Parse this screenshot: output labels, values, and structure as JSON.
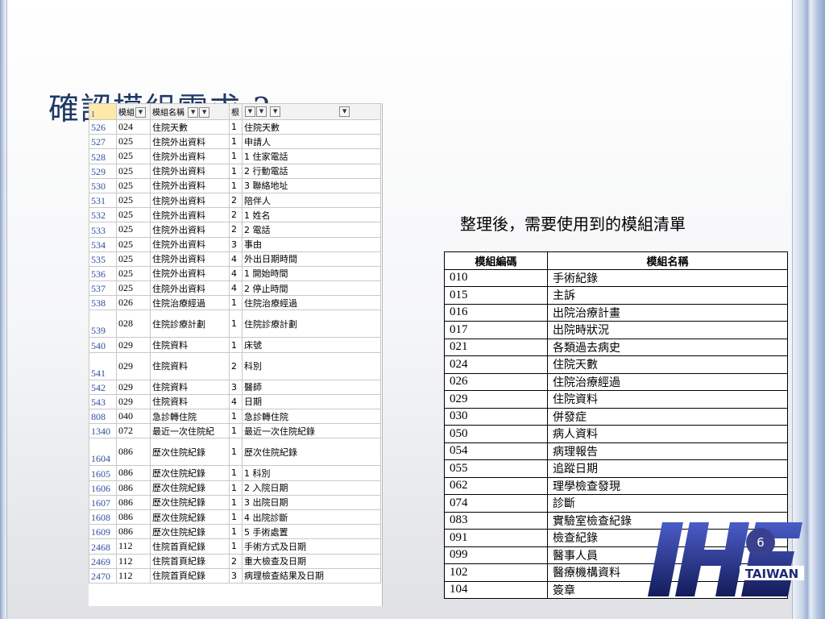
{
  "slide": {
    "title": "確認模組需求 ?",
    "caption": "整理後，需要使用到的模組清單",
    "page_number": "6"
  },
  "sheet": {
    "header": {
      "row": "1",
      "col_a": "模組",
      "col_b": "模組名稱",
      "col_c": "根",
      "col_d": ""
    },
    "rows": [
      {
        "rn": "526",
        "code": "024",
        "name": "住院天數",
        "n": "1",
        "item": "住院天數",
        "tall": false
      },
      {
        "rn": "527",
        "code": "025",
        "name": "住院外出資料",
        "n": "1",
        "item": "申請人",
        "tall": false
      },
      {
        "rn": "528",
        "code": "025",
        "name": "住院外出資料",
        "n": "1",
        "item": "1  住家電話",
        "tall": false
      },
      {
        "rn": "529",
        "code": "025",
        "name": "住院外出資料",
        "n": "1",
        "item": "2  行動電話",
        "tall": false
      },
      {
        "rn": "530",
        "code": "025",
        "name": "住院外出資料",
        "n": "1",
        "item": "3  聯絡地址",
        "tall": false
      },
      {
        "rn": "531",
        "code": "025",
        "name": "住院外出資料",
        "n": "2",
        "item": "陪伴人",
        "tall": false
      },
      {
        "rn": "532",
        "code": "025",
        "name": "住院外出資料",
        "n": "2",
        "item": "1  姓名",
        "tall": false
      },
      {
        "rn": "533",
        "code": "025",
        "name": "住院外出資料",
        "n": "2",
        "item": "2  電話",
        "tall": false
      },
      {
        "rn": "534",
        "code": "025",
        "name": "住院外出資料",
        "n": "3",
        "item": "事由",
        "tall": false
      },
      {
        "rn": "535",
        "code": "025",
        "name": "住院外出資料",
        "n": "4",
        "item": "外出日期時間",
        "tall": false
      },
      {
        "rn": "536",
        "code": "025",
        "name": "住院外出資料",
        "n": "4",
        "item": "1  開始時間",
        "tall": false
      },
      {
        "rn": "537",
        "code": "025",
        "name": "住院外出資料",
        "n": "4",
        "item": "2  停止時間",
        "tall": false
      },
      {
        "rn": "538",
        "code": "026",
        "name": "住院治療經過",
        "n": "1",
        "item": "住院治療經過",
        "tall": false
      },
      {
        "rn": "539",
        "code": "028",
        "name": "住院診療計劃",
        "n": "1",
        "item": "住院診療計劃",
        "tall": true
      },
      {
        "rn": "540",
        "code": "029",
        "name": "住院資料",
        "n": "1",
        "item": "床號",
        "tall": false
      },
      {
        "rn": "541",
        "code": "029",
        "name": "住院資料",
        "n": "2",
        "item": "科別",
        "tall": true
      },
      {
        "rn": "542",
        "code": "029",
        "name": "住院資料",
        "n": "3",
        "item": "醫師",
        "tall": false
      },
      {
        "rn": "543",
        "code": "029",
        "name": "住院資料",
        "n": "4",
        "item": "日期",
        "tall": false
      },
      {
        "rn": "808",
        "code": "040",
        "name": "急診轉住院",
        "n": "1",
        "item": "急診轉住院",
        "tall": false
      },
      {
        "rn": "1340",
        "code": "072",
        "name": "最近一次住院紀",
        "n": "1",
        "item": "最近一次住院紀錄",
        "tall": false
      },
      {
        "rn": "1604",
        "code": "086",
        "name": "歷次住院紀錄",
        "n": "1",
        "item": "歷次住院紀錄",
        "tall": true
      },
      {
        "rn": "1605",
        "code": "086",
        "name": "歷次住院紀錄",
        "n": "1",
        "item": "1  科別",
        "tall": false
      },
      {
        "rn": "1606",
        "code": "086",
        "name": "歷次住院紀錄",
        "n": "1",
        "item": "2  入院日期",
        "tall": false
      },
      {
        "rn": "1607",
        "code": "086",
        "name": "歷次住院紀錄",
        "n": "1",
        "item": "3  出院日期",
        "tall": false
      },
      {
        "rn": "1608",
        "code": "086",
        "name": "歷次住院紀錄",
        "n": "1",
        "item": "4  出院診斷",
        "tall": false
      },
      {
        "rn": "1609",
        "code": "086",
        "name": "歷次住院紀錄",
        "n": "1",
        "item": "5  手術處置",
        "tall": false
      },
      {
        "rn": "2468",
        "code": "112",
        "name": "住院首頁紀錄",
        "n": "1",
        "item": "手術方式及日期",
        "tall": false
      },
      {
        "rn": "2469",
        "code": "112",
        "name": "住院首頁紀錄",
        "n": "2",
        "item": "重大檢查及日期",
        "tall": false
      },
      {
        "rn": "2470",
        "code": "112",
        "name": "住院首頁紀錄",
        "n": "3",
        "item": "病理檢查結果及日期",
        "tall": false
      }
    ]
  },
  "module_table": {
    "headers": [
      "模組編碼",
      "模組名稱"
    ],
    "rows": [
      {
        "code": "010",
        "name": "手術紀錄"
      },
      {
        "code": "015",
        "name": "主訴"
      },
      {
        "code": "016",
        "name": "出院治療計畫"
      },
      {
        "code": "017",
        "name": "出院時狀況"
      },
      {
        "code": "021",
        "name": "各類過去病史"
      },
      {
        "code": "024",
        "name": "住院天數"
      },
      {
        "code": "026",
        "name": "住院治療經過"
      },
      {
        "code": "029",
        "name": "住院資料"
      },
      {
        "code": "030",
        "name": "併發症"
      },
      {
        "code": "050",
        "name": "病人資料"
      },
      {
        "code": "054",
        "name": "病理報告"
      },
      {
        "code": "055",
        "name": "追蹤日期"
      },
      {
        "code": "062",
        "name": "理學檢查發現"
      },
      {
        "code": "074",
        "name": "診斷"
      },
      {
        "code": "083",
        "name": "實驗室檢查紀錄"
      },
      {
        "code": "091",
        "name": "檢查紀錄"
      },
      {
        "code": "099",
        "name": "醫事人員"
      },
      {
        "code": "102",
        "name": "醫療機構資料"
      },
      {
        "code": "104",
        "name": "簽章"
      }
    ]
  },
  "logo": {
    "text": "IHE",
    "subtext": "TAIWAN",
    "color": "#1e2a78"
  }
}
